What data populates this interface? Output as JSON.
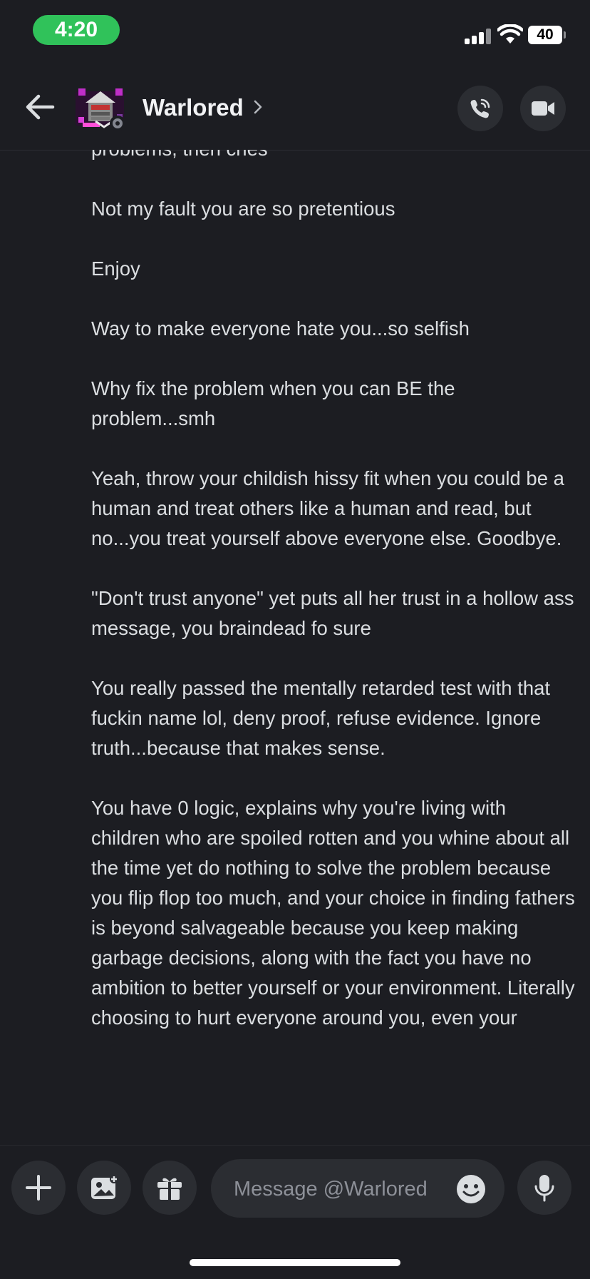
{
  "status_bar": {
    "time": "4:20",
    "battery": "40"
  },
  "header": {
    "channel_name": "Warlored",
    "icons": [
      "back-arrow-icon",
      "chevron-right-icon",
      "phone-call-icon",
      "video-camera-icon"
    ]
  },
  "messages": [
    "problems, then cries",
    "Not my fault you are so pretentious",
    "Enjoy",
    "Way to make everyone hate you...so selfish",
    "Why fix the problem when you can BE the problem...smh",
    "Yeah, throw your childish hissy fit when you could be a human and treat others like a human and read, but no...you treat yourself above everyone else. Goodbye.",
    "\"Don't trust anyone\" yet puts all her trust in a hollow ass message, you braindead fo sure",
    "You really passed the mentally retarded test with that fuckin name lol, deny proof, refuse evidence. Ignore truth...because that makes sense.",
    "You have 0 logic, explains why you're living with children who are spoiled rotten and you whine about all the time yet do nothing to solve the problem because you flip flop too much, and your choice in finding fathers is beyond salvageable because you keep making garbage decisions, along with the fact you have no ambition to better yourself or your environment. Literally choosing to hurt everyone around you, even your"
  ],
  "composer": {
    "placeholder": "Message @Warlored",
    "icons": [
      "plus-icon",
      "image-icon",
      "gift-icon",
      "emoji-icon",
      "microphone-icon"
    ]
  },
  "colors": {
    "background": "#1c1d22",
    "button_bg": "#2b2d32",
    "text": "#dbdee1",
    "time_pill": "#30c25a"
  }
}
